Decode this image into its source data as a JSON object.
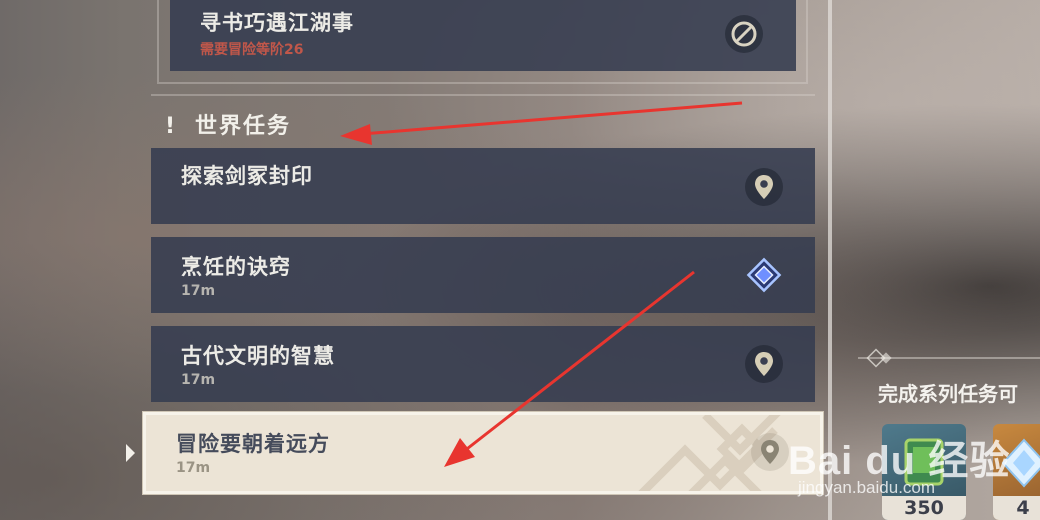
{
  "quests": {
    "locked": {
      "title": "寻书巧遇江湖事",
      "requirement": "需要冒险等阶26",
      "icon": "prohibited-icon"
    },
    "section": {
      "marker": "!",
      "title": "世界任务"
    },
    "items": [
      {
        "title": "探索剑冢封印",
        "distance": "",
        "icon": "map-pin-icon"
      },
      {
        "title": "烹饪的诀窍",
        "distance": "17m",
        "icon": "diamond-waypoint-icon"
      },
      {
        "title": "古代文明的智慧",
        "distance": "17m",
        "icon": "map-pin-icon"
      }
    ],
    "selected": {
      "title": "冒险要朝着远方",
      "distance": "17m",
      "icon": "map-pin-icon"
    }
  },
  "rewards": {
    "label": "完成系列任务可",
    "items": [
      {
        "icon": "experience-book-icon",
        "count": "350"
      },
      {
        "icon": "primogem-icon",
        "count": "4"
      }
    ]
  },
  "watermark": {
    "brand": "Bai du 经验",
    "url": "jingyan.baidu.com"
  },
  "colors": {
    "card": "#353c50",
    "selected_card": "#ece4d6",
    "requirement": "#c0574a",
    "arrow": "#e8352f"
  }
}
